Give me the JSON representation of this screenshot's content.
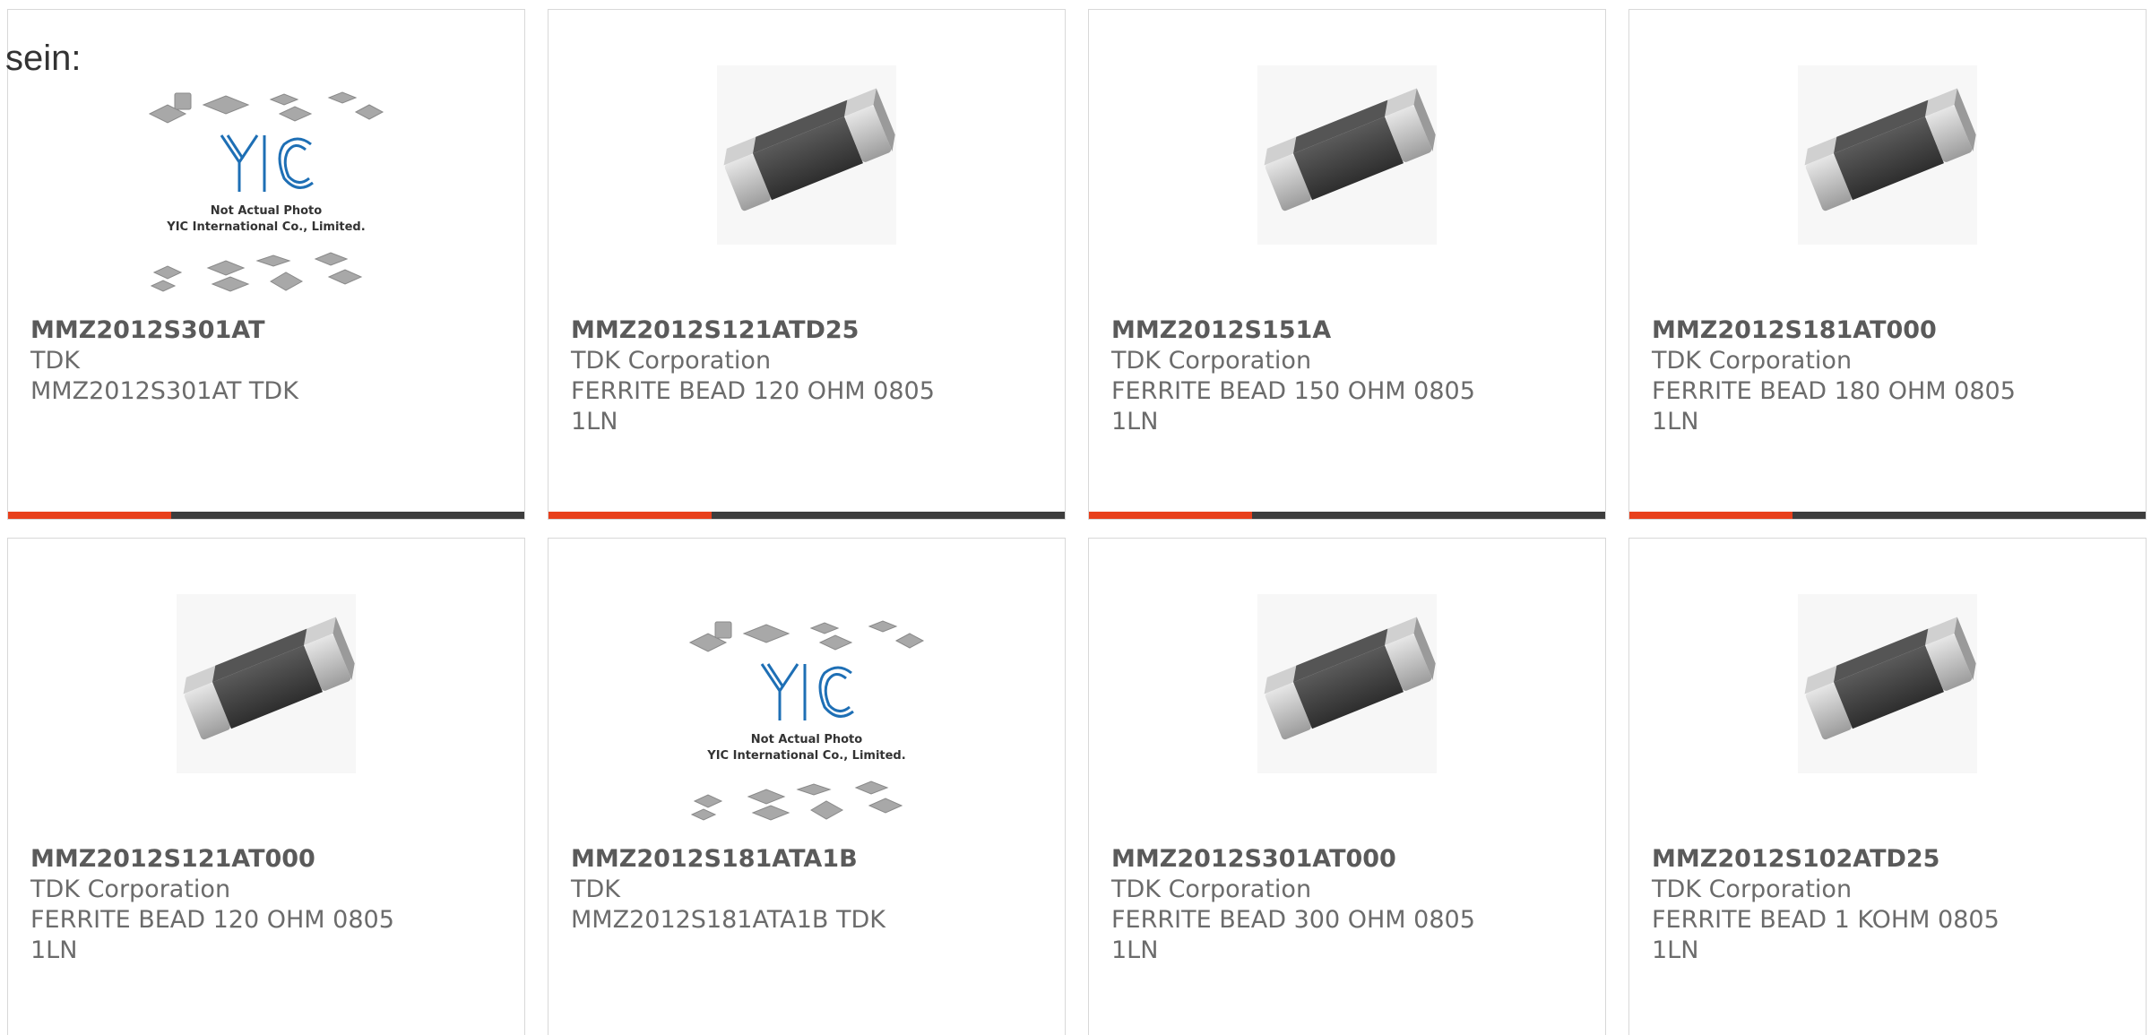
{
  "intro": {
    "text": "sein:"
  },
  "colors": {
    "accent": "#e8401c",
    "bar": "#3d3d3d"
  },
  "products": [
    {
      "part_number": "MMZ2012S301AT",
      "manufacturer": "TDK",
      "description": "MMZ2012S301AT TDK",
      "image": "yic-placeholder-image",
      "placeholder": {
        "line1": "Not Actual Photo",
        "line2": "YIC International Co., Limited."
      }
    },
    {
      "part_number": "MMZ2012S121ATD25",
      "manufacturer": "TDK Corporation",
      "description": "FERRITE BEAD 120 OHM 0805 1LN",
      "image": "ferrite-bead-image"
    },
    {
      "part_number": "MMZ2012S151A",
      "manufacturer": "TDK Corporation",
      "description": "FERRITE BEAD 150 OHM 0805 1LN",
      "image": "ferrite-bead-image"
    },
    {
      "part_number": "MMZ2012S181AT000",
      "manufacturer": "TDK Corporation",
      "description": "FERRITE BEAD 180 OHM 0805 1LN",
      "image": "ferrite-bead-image"
    },
    {
      "part_number": "MMZ2012S121AT000",
      "manufacturer": "TDK Corporation",
      "description": "FERRITE BEAD 120 OHM 0805 1LN",
      "image": "ferrite-bead-image"
    },
    {
      "part_number": "MMZ2012S181ATA1B",
      "manufacturer": "TDK",
      "description": "MMZ2012S181ATA1B TDK",
      "image": "yic-placeholder-image",
      "placeholder": {
        "line1": "Not Actual Photo",
        "line2": "YIC International Co., Limited."
      }
    },
    {
      "part_number": "MMZ2012S301AT000",
      "manufacturer": "TDK Corporation",
      "description": "FERRITE BEAD 300 OHM 0805 1LN",
      "image": "ferrite-bead-image"
    },
    {
      "part_number": "MMZ2012S102ATD25",
      "manufacturer": "TDK Corporation",
      "description": "FERRITE BEAD 1 KOHM 0805 1LN",
      "image": "ferrite-bead-image"
    }
  ]
}
